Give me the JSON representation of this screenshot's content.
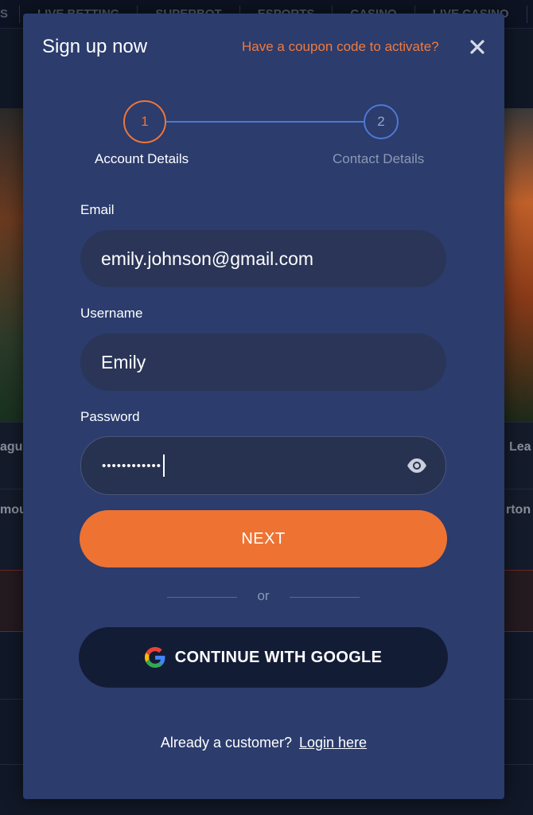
{
  "background": {
    "nav_items": [
      "S",
      "LIVE BETTING",
      "SUPERBOT",
      "ESPORTS",
      "CASINO",
      "LIVE CASINO"
    ],
    "left_fragments": [
      "ague",
      "mou"
    ],
    "right_fragments": [
      "Lea",
      "rton"
    ]
  },
  "modal": {
    "title": "Sign up now",
    "coupon_link": "Have a coupon code to activate?",
    "close_icon": "close-icon"
  },
  "stepper": {
    "steps": [
      {
        "number": "1",
        "label": "Account Details",
        "state": "active"
      },
      {
        "number": "2",
        "label": "Contact Details",
        "state": "inactive"
      }
    ]
  },
  "form": {
    "email_label": "Email",
    "email_value": "emily.johnson@gmail.com",
    "username_label": "Username",
    "username_value": "Emily",
    "password_label": "Password",
    "password_value": "••••••••••••",
    "show_password_icon": "eye-icon"
  },
  "actions": {
    "next_label": "NEXT",
    "or_label": "or",
    "google_label": "CONTINUE WITH GOOGLE",
    "google_icon": "google-icon"
  },
  "footer": {
    "prompt": "Already a customer?",
    "login_link": "Login here"
  },
  "colors": {
    "accent": "#EE7333",
    "modal_bg": "#2B3C6D",
    "google_btn_bg": "#131C35",
    "step_line": "#4F78D4"
  }
}
